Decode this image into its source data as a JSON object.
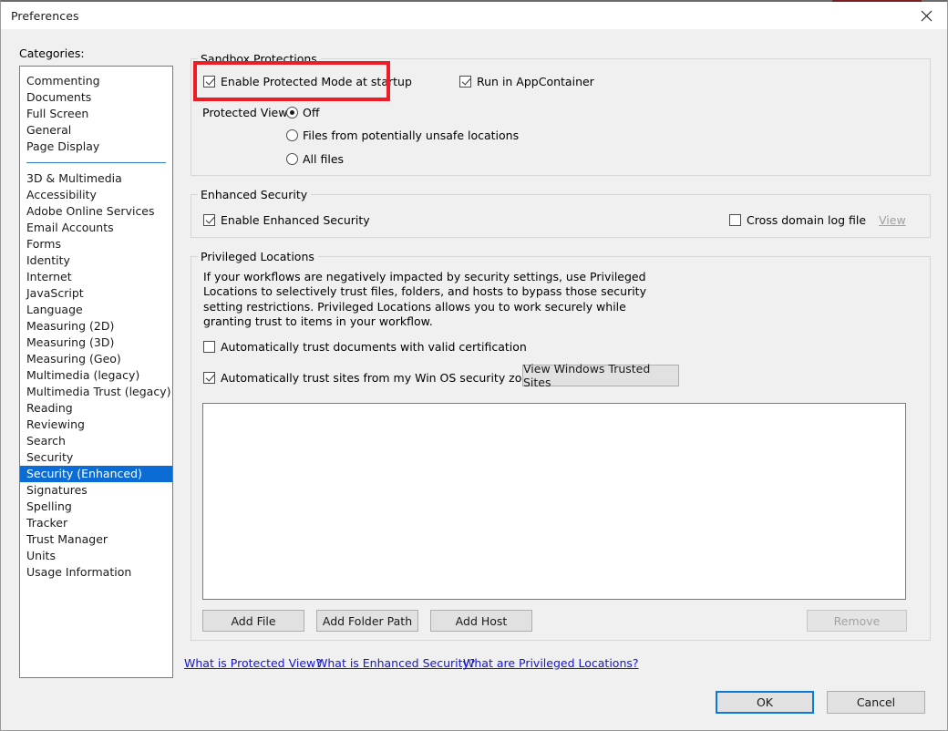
{
  "window": {
    "title": "Preferences",
    "close_icon": "close-icon"
  },
  "sidebar": {
    "label": "Categories:",
    "selected": "Security (Enhanced)",
    "group_one": [
      "Commenting",
      "Documents",
      "Full Screen",
      "General",
      "Page Display"
    ],
    "group_two": [
      "3D & Multimedia",
      "Accessibility",
      "Adobe Online Services",
      "Email Accounts",
      "Forms",
      "Identity",
      "Internet",
      "JavaScript",
      "Language",
      "Measuring (2D)",
      "Measuring (3D)",
      "Measuring (Geo)",
      "Multimedia (legacy)",
      "Multimedia Trust (legacy)",
      "Reading",
      "Reviewing",
      "Search",
      "Security",
      "Security (Enhanced)",
      "Signatures",
      "Spelling",
      "Tracker",
      "Trust Manager",
      "Units",
      "Usage Information"
    ]
  },
  "sandbox": {
    "title": "Sandbox Protections",
    "enable_protected_mode": {
      "label": "Enable Protected Mode at startup",
      "checked": true,
      "highlighted": true
    },
    "run_in_appcontainer": {
      "label": "Run in AppContainer",
      "checked": true
    },
    "protected_view": {
      "label": "Protected View",
      "selected": "Off",
      "options": [
        "Off",
        "Files from potentially unsafe locations",
        "All files"
      ]
    }
  },
  "enhanced_security": {
    "title": "Enhanced Security",
    "enable": {
      "label": "Enable Enhanced Security",
      "checked": true
    },
    "cross_domain_log": {
      "label": "Cross domain log file",
      "checked": false
    },
    "view_link": "View"
  },
  "privileged_locations": {
    "title": "Privileged Locations",
    "description": "If your workflows are negatively impacted by security settings, use Privileged Locations to selectively trust files, folders, and hosts to bypass those security setting restrictions. Privileged Locations allows you to work securely while granting trust to items in your workflow.",
    "auto_trust_certified": {
      "label": "Automatically trust documents with valid certification",
      "checked": false
    },
    "auto_trust_sites": {
      "label": "Automatically trust sites from my Win OS security zones",
      "checked": true
    },
    "view_trusted_sites_button": "View Windows Trusted Sites",
    "list_items": [],
    "buttons": {
      "add_file": "Add File",
      "add_folder_path": "Add Folder Path",
      "add_host": "Add Host",
      "remove": "Remove"
    }
  },
  "help_links": [
    "What is Protected View?",
    "What is Enhanced Security?",
    "What are Privileged Locations?"
  ],
  "footer": {
    "ok": "OK",
    "cancel": "Cancel"
  },
  "colors": {
    "accent": "#0a6cd4",
    "highlight_box": "#ee1c25",
    "link": "#1515cf",
    "dialog_bg": "#f0f0f0"
  }
}
